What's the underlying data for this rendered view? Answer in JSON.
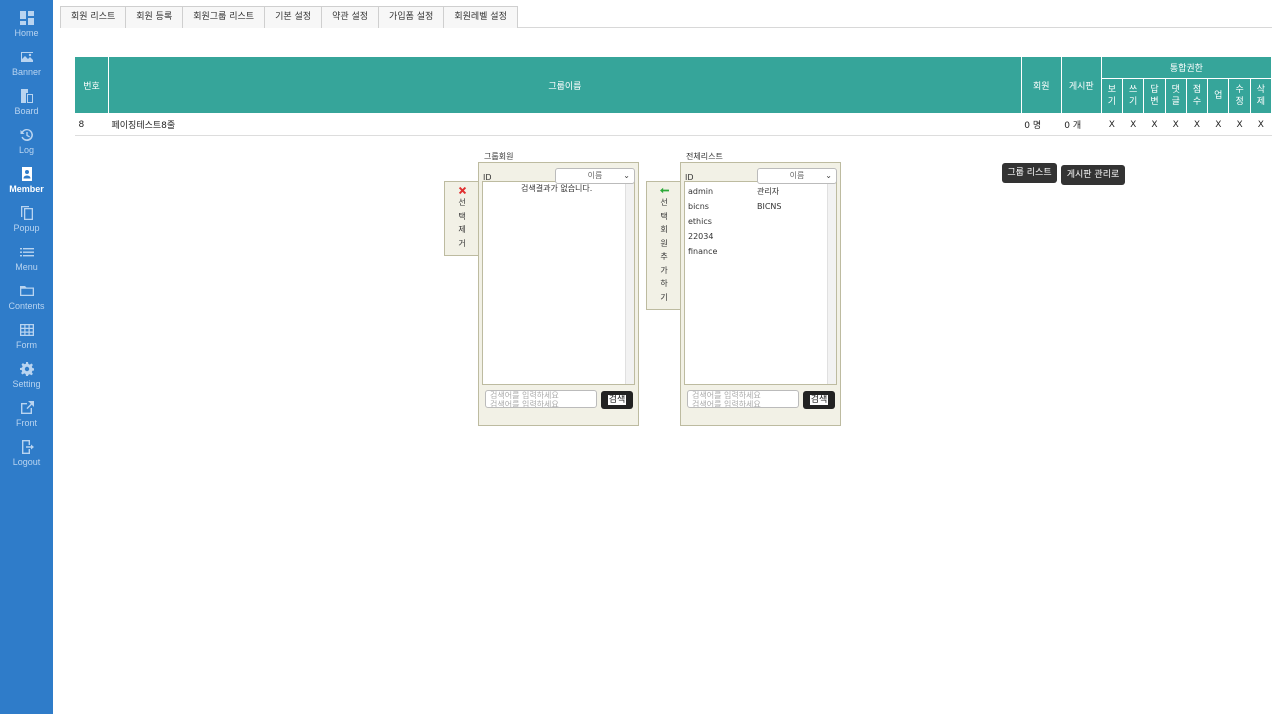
{
  "sidebar": {
    "items": [
      {
        "label": "Home",
        "icon": "home-icon"
      },
      {
        "label": "Banner",
        "icon": "image-icon"
      },
      {
        "label": "Board",
        "icon": "board-icon"
      },
      {
        "label": "Log",
        "icon": "history-icon"
      },
      {
        "label": "Member",
        "icon": "member-icon"
      },
      {
        "label": "Popup",
        "icon": "copy-icon"
      },
      {
        "label": "Menu",
        "icon": "list-icon"
      },
      {
        "label": "Contents",
        "icon": "folder-icon"
      },
      {
        "label": "Form",
        "icon": "table-icon"
      },
      {
        "label": "Setting",
        "icon": "gear-icon"
      },
      {
        "label": "Front",
        "icon": "external-link-icon"
      },
      {
        "label": "Logout",
        "icon": "logout-icon"
      }
    ],
    "active": "Member"
  },
  "tabs": [
    "회원 리스트",
    "회원 등록",
    "회원그룹 리스트",
    "기본 설정",
    "약관 설정",
    "가입폼 설정",
    "회원레벨 설정"
  ],
  "group_table": {
    "headers": {
      "number": "번호",
      "group_name": "그룹이름",
      "members": "회원",
      "board": "게시판",
      "permissions": "통합권한"
    },
    "permission_headers": [
      "보기",
      "쓰기",
      "답변",
      "댓글",
      "점수",
      "업",
      "수정",
      "삭제"
    ],
    "row": {
      "number": "8",
      "group_name": "페이징테스트8줄",
      "members": "0 명",
      "board": "0 개",
      "permissions": [
        "X",
        "X",
        "X",
        "X",
        "X",
        "X",
        "X",
        "X"
      ]
    }
  },
  "group_members_panel": {
    "title": "그룹회원",
    "id_label": "ID",
    "select_value": "이름",
    "empty_message": "검색결과가 없습니다.",
    "side_button_label": "선택제거",
    "search_placeholder": "검색어를 입력하세요",
    "search_button": "검색"
  },
  "all_list_panel": {
    "title": "전체리스트",
    "id_label": "ID",
    "select_value": "이름",
    "side_button_label": "선택회원추가하기",
    "rows": [
      {
        "id": "admin",
        "name": "관리자"
      },
      {
        "id": "bicns",
        "name": "BICNS"
      },
      {
        "id": "ethics",
        "name": ""
      },
      {
        "id": "22034",
        "name": ""
      },
      {
        "id": "finance",
        "name": ""
      }
    ],
    "search_placeholder": "검색어를 입력하세요",
    "search_button": "검색"
  },
  "buttons": {
    "group_list": "그룹 리스트",
    "board_manage": "게시판 관리로"
  },
  "colors": {
    "sidebar": "#2f7cc9",
    "table_header": "#36a59a",
    "panel_bg": "#f2f1e6",
    "remove_icon": "#e03030",
    "add_icon": "#2eaa3a"
  }
}
